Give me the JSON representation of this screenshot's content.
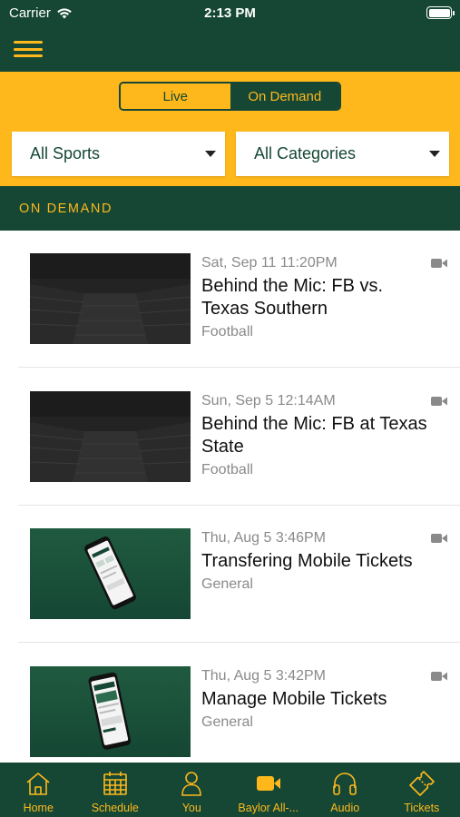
{
  "status_bar": {
    "carrier": "Carrier",
    "time": "2:13 PM"
  },
  "segmented_control": {
    "live_label": "Live",
    "on_demand_label": "On Demand",
    "selected": "On Demand"
  },
  "filters": {
    "sports": "All Sports",
    "categories": "All Categories"
  },
  "section_header": "ON DEMAND",
  "videos": [
    {
      "date": "Sat, Sep 11 11:20PM",
      "title": "Behind the Mic: FB vs. Texas Southern",
      "category": "Football",
      "thumb": "stadium"
    },
    {
      "date": "Sun, Sep 5 12:14AM",
      "title": "Behind the Mic: FB at Texas State",
      "category": "Football",
      "thumb": "stadium"
    },
    {
      "date": "Thu, Aug 5 3:46PM",
      "title": "Transfering Mobile Tickets",
      "category": "General",
      "thumb": "phone"
    },
    {
      "date": "Thu, Aug 5 3:42PM",
      "title": "Manage Mobile Tickets",
      "category": "General",
      "thumb": "phone"
    }
  ],
  "tab_bar": {
    "tabs": [
      {
        "label": "Home",
        "icon": "home-icon"
      },
      {
        "label": "Schedule",
        "icon": "calendar-icon"
      },
      {
        "label": "You",
        "icon": "person-icon"
      },
      {
        "label": "Baylor All-...",
        "icon": "video-camera-icon"
      },
      {
        "label": "Audio",
        "icon": "headphones-icon"
      },
      {
        "label": "Tickets",
        "icon": "ticket-icon"
      }
    ]
  },
  "colors": {
    "green": "#154734",
    "gold": "#FFB81C",
    "muted_text": "#8a8a8a"
  }
}
